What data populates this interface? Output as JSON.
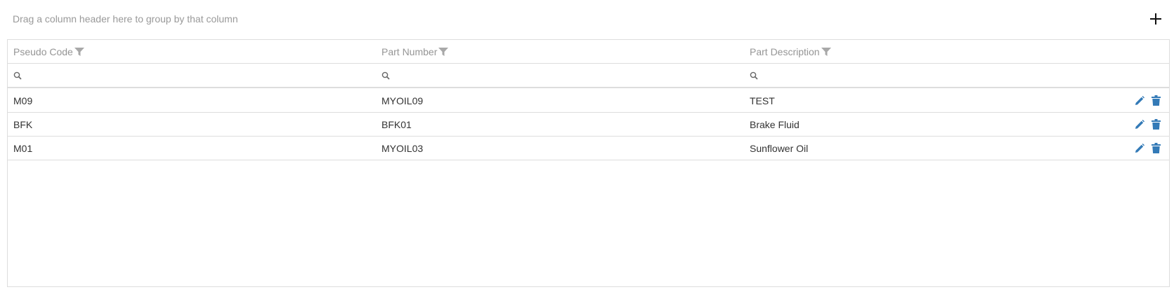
{
  "group_panel": {
    "text": "Drag a column header here to group by that column"
  },
  "toolbar": {
    "add_icon": "plus-icon"
  },
  "grid": {
    "columns": [
      {
        "label": "Pseudo Code",
        "icon": "filter-icon"
      },
      {
        "label": "Part Number",
        "icon": "filter-icon"
      },
      {
        "label": "Part Description",
        "icon": "filter-icon"
      }
    ],
    "filter_icon": "search-icon",
    "rows": [
      {
        "pseudo_code": "M09",
        "part_number": "MYOIL09",
        "part_description": "TEST"
      },
      {
        "pseudo_code": "BFK",
        "part_number": "BFK01",
        "part_description": "Brake Fluid"
      },
      {
        "pseudo_code": "M01",
        "part_number": "MYOIL03",
        "part_description": "Sunflower Oil"
      }
    ],
    "row_actions": {
      "edit_icon": "pencil-icon",
      "delete_icon": "trash-icon"
    }
  },
  "colors": {
    "accent": "#337ab7",
    "muted_text": "#999999",
    "border": "#dddddd"
  }
}
